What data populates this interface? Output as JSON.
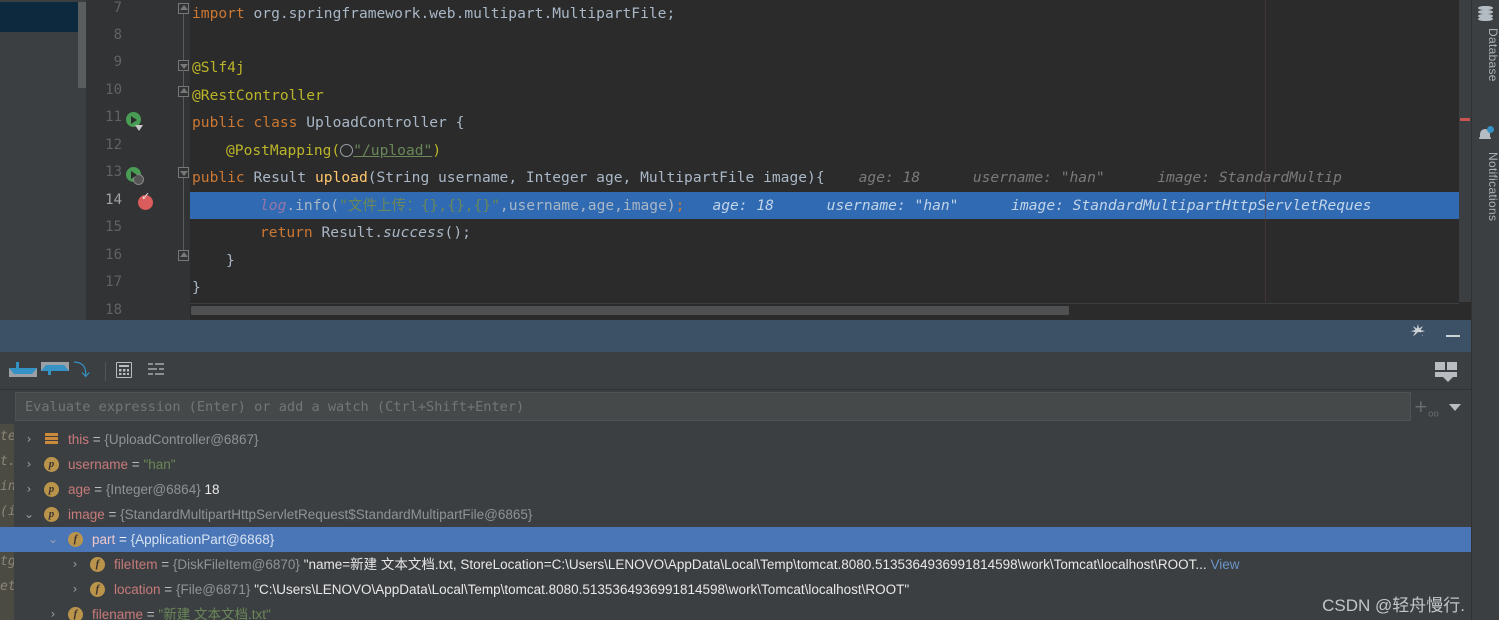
{
  "editor": {
    "lines": [
      {
        "n": "7",
        "fold": "up"
      },
      {
        "n": "8",
        "fold": ""
      },
      {
        "n": "9",
        "fold": "down"
      },
      {
        "n": "10",
        "fold": "up"
      },
      {
        "n": "11",
        "fold": ""
      },
      {
        "n": "12",
        "fold": ""
      },
      {
        "n": "13",
        "fold": "down"
      },
      {
        "n": "14",
        "fold": ""
      },
      {
        "n": "15",
        "fold": ""
      },
      {
        "n": "16",
        "fold": "up"
      },
      {
        "n": "17",
        "fold": ""
      },
      {
        "n": "18",
        "fold": ""
      }
    ],
    "code": {
      "l7_kw": "import",
      "l7_rest": " org.springframework.web.multipart.MultipartFile;",
      "l9": "@Slf4j",
      "l10": "@RestController",
      "l11_kw": "public class ",
      "l11_name": "UploadController",
      "l11_brace": " {",
      "l12_anno": "@PostMapping(",
      "l12_str": "\"/upload\"",
      "l12_close": ")",
      "l13_kw": "public",
      "l13_type": " Result ",
      "l13_fn": "upload",
      "l13_params": "(String username, Integer age, MultipartFile image){",
      "l13_hint": "age: 18      username: \"han\"      image: StandardMultip",
      "l14_log": "log",
      "l14_info": ".info(",
      "l14_str": "\"文件上传：{},{},{}\"",
      "l14_args": ",username,age,image)",
      "l14_semi": ";",
      "l14_hint": "age: 18      username: \"han\"      image: StandardMultipartHttpServletReques",
      "l15_kw": "return",
      "l15_rest": " Result.",
      "l15_mth": "success",
      "l15_end": "();",
      "l16": "}",
      "l17": "}"
    },
    "gutter_markers": [
      {
        "line": "11",
        "type": "run-class-icon"
      },
      {
        "line": "13",
        "type": "run-method-icon"
      },
      {
        "line": "14",
        "type": "breakpoint-verified-icon"
      }
    ]
  },
  "right_tool_bar": {
    "tabs": [
      {
        "label": "Database",
        "icon": "database-icon"
      },
      {
        "label": "Notifications",
        "icon": "bell-icon"
      }
    ]
  },
  "debug_panel": {
    "header": {
      "settings_icon": "gear-icon",
      "minimize_icon": "minimize-icon"
    },
    "toolbar": {
      "step_into": "step-into-icon",
      "step_out": "step-out-icon",
      "force_step_into": "force-step-into-icon",
      "evaluate": "calculator-icon",
      "mute": "sort-filter-icon",
      "layout": "layout-settings-icon"
    },
    "evaluate": {
      "placeholder": "Evaluate expression (Enter) or add a watch (Ctrl+Shift+Enter)",
      "value": "",
      "add_watch_icon": "add-watch-icon",
      "dropdown_icon": "chevron-down-icon"
    },
    "variables": [
      {
        "indent": 0,
        "chevron": "›",
        "expanded": false,
        "icon": "stack",
        "icon_label": "",
        "name": "this",
        "eq": " = ",
        "type": "{UploadController@6867}",
        "value": "",
        "value_kind": "none",
        "selected": false
      },
      {
        "indent": 0,
        "chevron": "›",
        "expanded": false,
        "icon": "p",
        "icon_label": "p",
        "name": "username",
        "eq": " = ",
        "type": "",
        "value": "\"han\"",
        "value_kind": "string",
        "selected": false
      },
      {
        "indent": 0,
        "chevron": "›",
        "expanded": false,
        "icon": "p",
        "icon_label": "p",
        "name": "age",
        "eq": " = ",
        "type": "{Integer@6864}",
        "value": "18",
        "value_kind": "number",
        "selected": false
      },
      {
        "indent": 0,
        "chevron": "⌄",
        "expanded": true,
        "icon": "p",
        "icon_label": "p",
        "name": "image",
        "eq": " = ",
        "type": "{StandardMultipartHttpServletRequest$StandardMultipartFile@6865}",
        "value": "",
        "value_kind": "none",
        "selected": false
      },
      {
        "indent": 1,
        "chevron": "⌄",
        "expanded": true,
        "icon": "f",
        "icon_label": "f",
        "name": "part",
        "eq": " = ",
        "type": "{ApplicationPart@6868}",
        "value": "",
        "value_kind": "none",
        "selected": true
      },
      {
        "indent": 2,
        "chevron": "›",
        "expanded": false,
        "icon": "f",
        "icon_label": "f",
        "name": "fileItem",
        "eq": " = ",
        "type": "{DiskFileItem@6870}",
        "value": "\"name=新建 文本文档.txt, StoreLocation=C:\\Users\\LENOVO\\AppData\\Local\\Temp\\tomcat.8080.5135364936991814598\\work\\Tomcat\\localhost\\ROOT...",
        "value_kind": "plain",
        "link": "View",
        "selected": false
      },
      {
        "indent": 2,
        "chevron": "›",
        "expanded": false,
        "icon": "f",
        "icon_label": "f",
        "name": "location",
        "eq": " = ",
        "type": "{File@6871}",
        "value": "\"C:\\Users\\LENOVO\\AppData\\Local\\Temp\\tomcat.8080.5135364936991814598\\work\\Tomcat\\localhost\\ROOT\"",
        "value_kind": "plain",
        "selected": false
      },
      {
        "indent": 1,
        "chevron": "›",
        "expanded": false,
        "icon": "f",
        "icon_label": "f",
        "name": "filename",
        "eq": " = ",
        "type": "",
        "value": "\"新建 文本文档.txt\"",
        "value_kind": "string",
        "selected": false
      }
    ]
  },
  "watermark": "CSDN @轻舟慢行.",
  "colors": {
    "editor_bg": "#2b2b2b",
    "panel_bg": "#3c3f41",
    "selection_blue": "#2f6ab2",
    "tree_selection": "#4a76b8",
    "debug_header": "#3c5066",
    "keyword_orange": "#cc7832",
    "annotation_yellow": "#bbb529",
    "string_green": "#6a8759",
    "method_gold": "#ffc66d",
    "field_purple": "#9876aa",
    "var_name_red": "#c77a7a",
    "accent_blue": "#3592c4"
  }
}
